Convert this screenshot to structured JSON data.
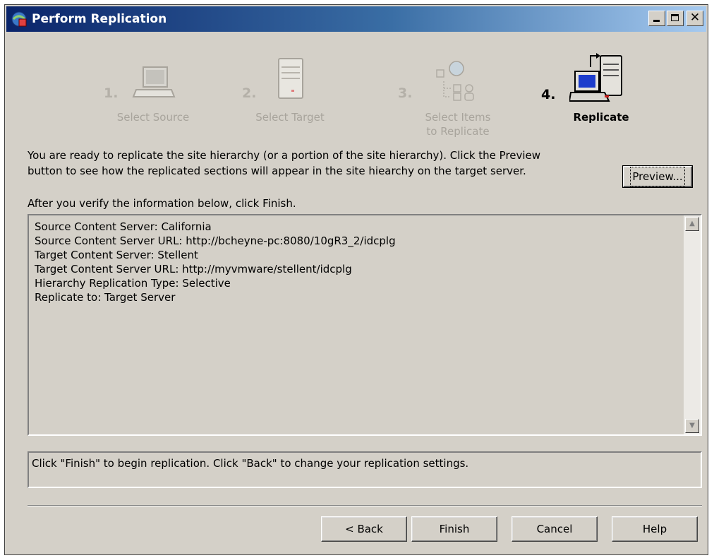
{
  "window": {
    "title": "Perform Replication"
  },
  "steps": [
    {
      "number": "1.",
      "label": "Select Source",
      "active": false
    },
    {
      "number": "2.",
      "label": "Select Target",
      "active": false
    },
    {
      "number": "3.",
      "label_line1": "Select Items",
      "label_line2": "to Replicate",
      "active": false
    },
    {
      "number": "4.",
      "label": "Replicate",
      "active": true
    }
  ],
  "intro": {
    "line1": "You are ready to replicate the site hierarchy (or a portion of the site hierarchy).  Click the Preview",
    "line2": "button to see how the replicated sections will appear in the site hiearchy on the target server."
  },
  "preview_button": {
    "label": "Preview..."
  },
  "verify_text": "After you verify the information below, click Finish.",
  "summary": [
    "Source Content Server: California",
    "Source Content Server URL: http://bcheyne-pc:8080/10gR3_2/idcplg",
    "Target Content Server: Stellent",
    "Target Content Server URL: http://myvmware/stellent/idcplg",
    "Hierarchy Replication Type: Selective",
    "Replicate to: Target Server"
  ],
  "status_text": "Click \"Finish\" to begin replication.  Click \"Back\" to change your replication settings.",
  "buttons": {
    "back": "< Back",
    "finish": "Finish",
    "cancel": "Cancel",
    "help": "Help"
  }
}
